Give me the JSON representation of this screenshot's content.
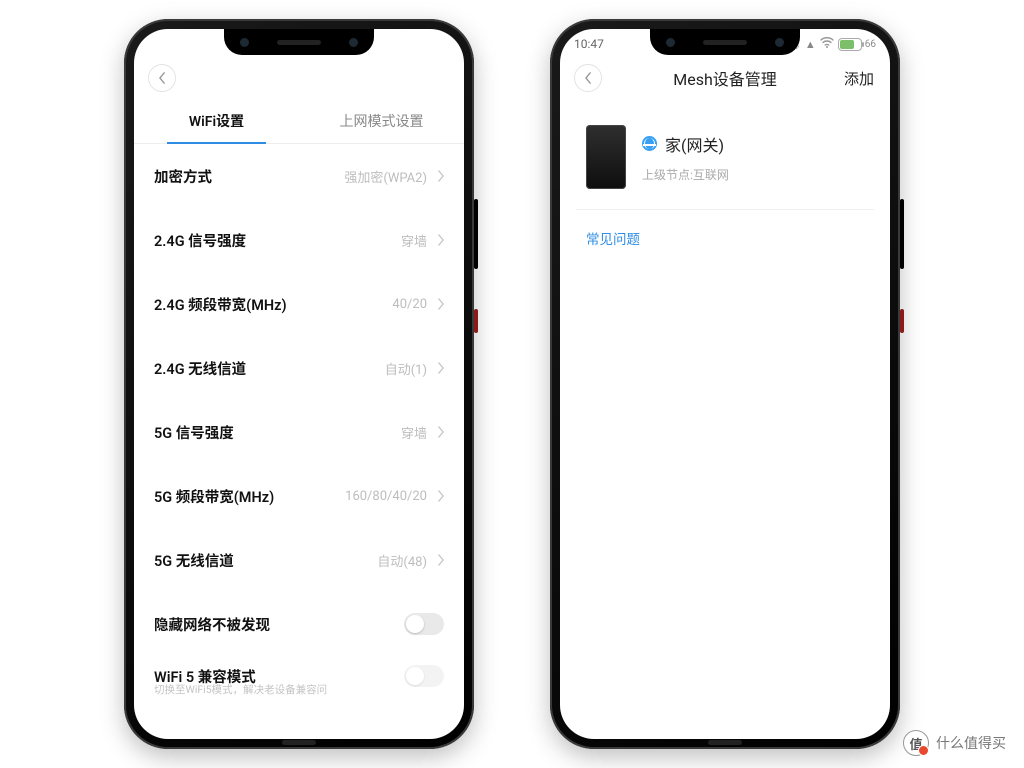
{
  "left": {
    "tabs": {
      "wifi": "WiFi设置",
      "internet": "上网模式设置"
    },
    "rows": {
      "encryption": {
        "label": "加密方式",
        "value": "强加密(WPA2)"
      },
      "sig24": {
        "label": "2.4G 信号强度",
        "value": "穿墙"
      },
      "bw24": {
        "label": "2.4G 频段带宽(MHz)",
        "value": "40/20"
      },
      "ch24": {
        "label": "2.4G 无线信道",
        "value": "自动(1)"
      },
      "sig5": {
        "label": "5G 信号强度",
        "value": "穿墙"
      },
      "bw5": {
        "label": "5G 频段带宽(MHz)",
        "value": "160/80/40/20"
      },
      "ch5": {
        "label": "5G 无线信道",
        "value": "自动(48)"
      },
      "hide": {
        "label": "隐藏网络不被发现"
      },
      "wifi5": {
        "label": "WiFi 5 兼容模式",
        "sub": "切换至WiFi5模式，解决老设备兼容问"
      }
    }
  },
  "right": {
    "status": {
      "time": "10:47",
      "battery": "66"
    },
    "nav": {
      "title": "Mesh设备管理",
      "action": "添加"
    },
    "device": {
      "name": "家(网关)",
      "subtitle": "上级节点:互联网"
    },
    "faq": "常见问题"
  },
  "watermark": {
    "glyph": "值",
    "text": "什么值得买"
  }
}
